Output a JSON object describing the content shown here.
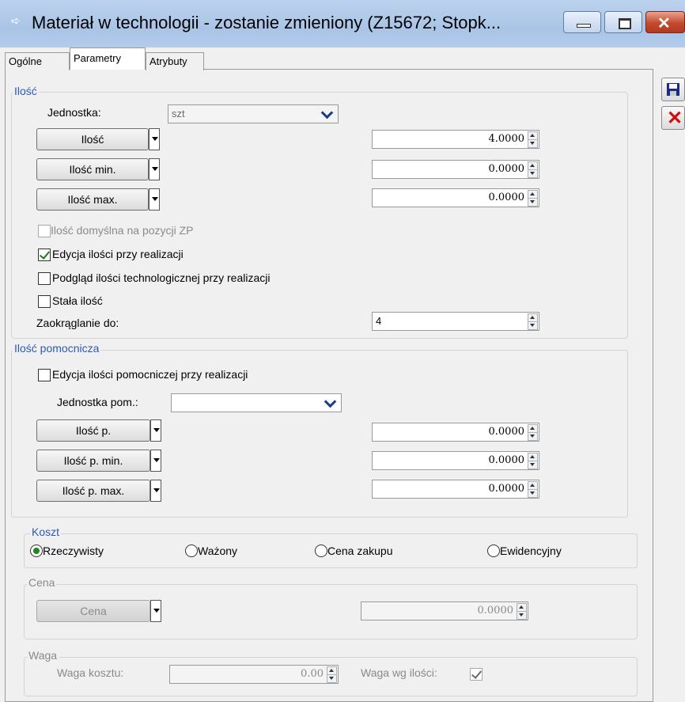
{
  "window": {
    "title": "Materiał w technologii - zostanie zmieniony  (Z15672; Stopk..."
  },
  "tabs": [
    "Ogólne",
    "Parametry",
    "Atrybuty"
  ],
  "ilosc_group": {
    "label": "Ilość",
    "jednostka_label": "Jednostka:",
    "jednostka_value": "szt",
    "rows": [
      {
        "button": "Ilość",
        "value": "4.0000"
      },
      {
        "button": "Ilość min.",
        "value": "0.0000"
      },
      {
        "button": "Ilość max.",
        "value": "0.0000"
      }
    ],
    "checkboxes": [
      {
        "label": "Ilość domyślna na pozycji ZP",
        "checked": false,
        "disabled": true
      },
      {
        "label": "Edycja ilości przy realizacji",
        "checked": true,
        "disabled": false
      },
      {
        "label": "Podgląd ilości technologicznej przy realizacji",
        "checked": false,
        "disabled": false
      },
      {
        "label": "Stała ilość",
        "checked": false,
        "disabled": false
      }
    ],
    "zaokraglanie_label": "Zaokrąglanie do:",
    "zaokraglanie_value": "4"
  },
  "ilosc_pom_group": {
    "label": "Ilość pomocnicza",
    "checkbox_label": "Edycja ilości pomocniczej przy realizacji",
    "checkbox_checked": false,
    "jednostka_label": "Jednostka pom.:",
    "jednostka_value": "",
    "rows": [
      {
        "button": "Ilość p.",
        "value": "0.0000"
      },
      {
        "button": "Ilość p. min.",
        "value": "0.0000"
      },
      {
        "button": "Ilość p. max.",
        "value": "0.0000"
      }
    ]
  },
  "koszt_group": {
    "label": "Koszt",
    "options": [
      "Rzeczywisty",
      "Ważony",
      "Cena zakupu",
      "Ewidencyjny"
    ],
    "selected": "Rzeczywisty"
  },
  "cena_group": {
    "label": "Cena",
    "button": "Cena",
    "value": "0.0000"
  },
  "waga_group": {
    "label": "Waga",
    "waga_kosztu_label": "Waga kosztu:",
    "waga_kosztu_value": "0.00",
    "waga_wg_ilosci_label": "Waga wg ilości:",
    "waga_wg_ilosci_checked": true
  },
  "colors": {
    "group_label": "#2b5ab8",
    "titlebar": "#a9c4e6",
    "close_button": "#c44a2e"
  }
}
